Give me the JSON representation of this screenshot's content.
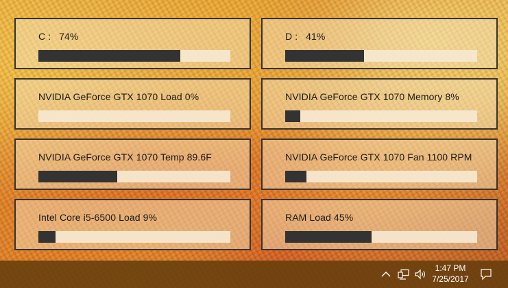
{
  "tiles": [
    {
      "label": "C :   74%",
      "fraction": 0.74
    },
    {
      "label": "D :   41%",
      "fraction": 0.41
    },
    {
      "label": "NVIDIA GeForce GTX 1070 Load 0%",
      "fraction": 0.0
    },
    {
      "label": "NVIDIA GeForce GTX 1070 Memory 8%",
      "fraction": 0.08
    },
    {
      "label": "NVIDIA GeForce GTX 1070 Temp 89.6F",
      "fraction": 0.41
    },
    {
      "label": "NVIDIA GeForce GTX 1070 Fan 1100 RPM",
      "fraction": 0.11
    },
    {
      "label": "Intel Core i5-6500 Load 9%",
      "fraction": 0.09
    },
    {
      "label": "RAM Load 45%",
      "fraction": 0.45
    }
  ],
  "taskbar": {
    "time": "1:47 PM",
    "date": "7/25/2017",
    "icons": [
      "chevron-up-icon",
      "network-icon",
      "volume-icon",
      "notification-icon"
    ]
  },
  "colors": {
    "bar_fill": "#333333",
    "bar_track": "#f6e8d0",
    "tile_border": "#333333",
    "taskbar": "#653e0c"
  }
}
